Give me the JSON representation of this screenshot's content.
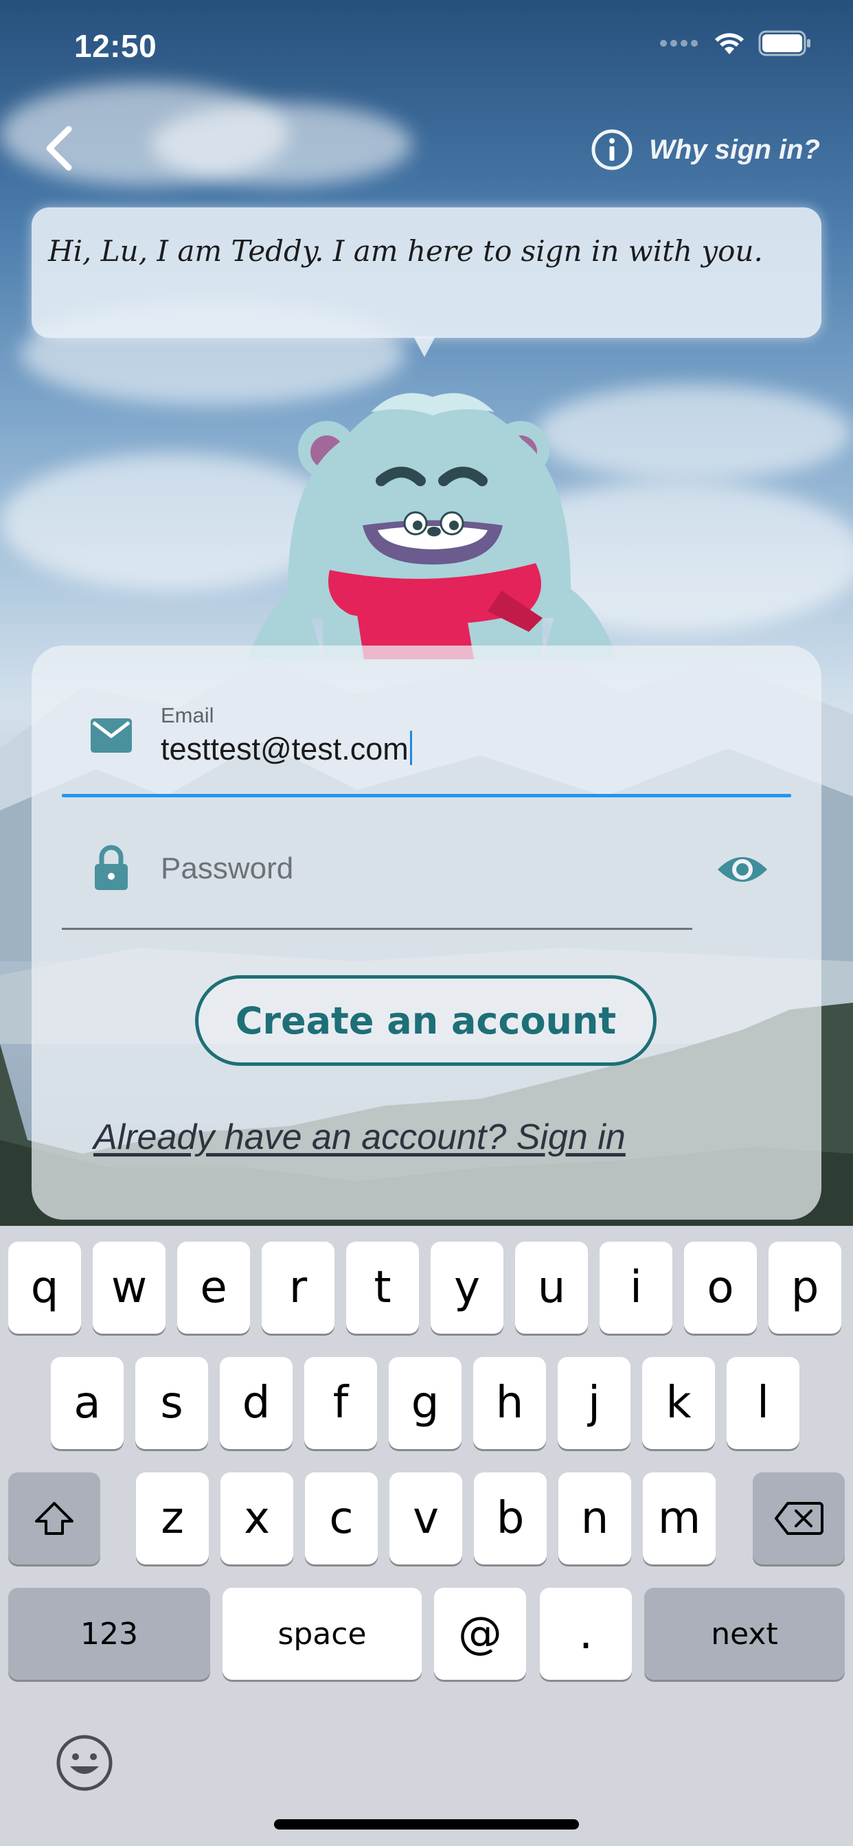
{
  "status_bar": {
    "time": "12:50"
  },
  "header": {
    "back_icon": "chevron-left-icon",
    "info_icon": "info-icon",
    "why_label": "Why sign in?"
  },
  "mascot": {
    "speech": "Hi, Lu, I am Teddy. I am here to sign in with you.",
    "name": "Teddy"
  },
  "form": {
    "email": {
      "icon": "envelope-icon",
      "label": "Email",
      "value": "testtest@test.com"
    },
    "password": {
      "icon": "lock-icon",
      "placeholder": "Password",
      "toggle_icon": "eye-icon"
    },
    "create_button": "Create an account",
    "signin_link": "Already have an account? Sign in"
  },
  "keyboard": {
    "row1": [
      "q",
      "w",
      "e",
      "r",
      "t",
      "y",
      "u",
      "i",
      "o",
      "p"
    ],
    "row2": [
      "a",
      "s",
      "d",
      "f",
      "g",
      "h",
      "j",
      "k",
      "l"
    ],
    "row3": [
      "z",
      "x",
      "c",
      "v",
      "b",
      "n",
      "m"
    ],
    "shift_icon": "shift-icon",
    "delete_icon": "backspace-icon",
    "numbers": "123",
    "space": "space",
    "at": "@",
    "dot": ".",
    "next": "next",
    "emoji_icon": "emoji-icon"
  },
  "colors": {
    "accent_blue": "#2196f3",
    "teal": "#1e6f77",
    "icon_teal": "#4a919e"
  }
}
